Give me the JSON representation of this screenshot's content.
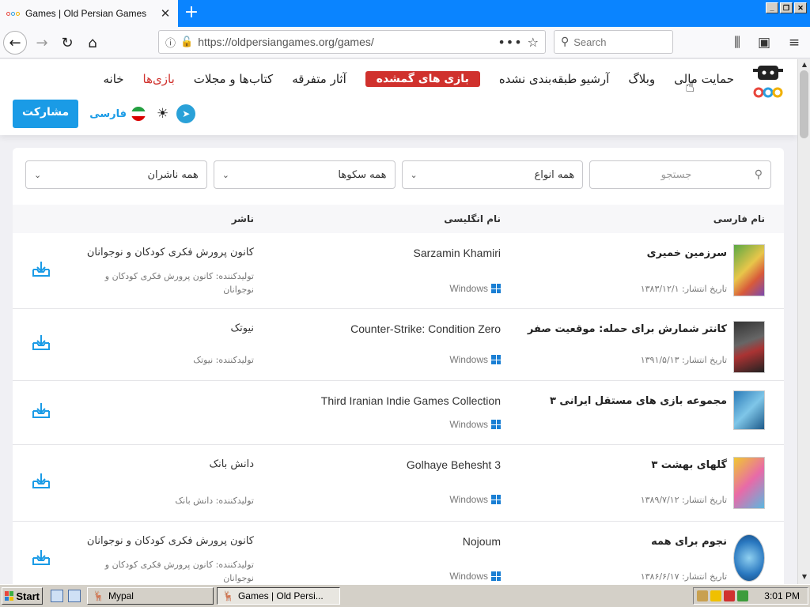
{
  "browser": {
    "tab_title": "Games | Old Persian Games",
    "tab_close": "✕",
    "new_tab": "+",
    "url": "https://oldpersiangames.org/games/",
    "search_placeholder": "Search"
  },
  "site": {
    "menu": [
      "خانه",
      "بازی‌ها",
      "کتاب‌ها و مجلات",
      "آثار متفرقه",
      "بازی های گمشده",
      "آرشیو طبقه‌بندی نشده",
      "وبلاگ",
      "حمایت مالی"
    ],
    "active_menu": "بازی‌ها",
    "lost_games_color": "#d0312d",
    "share_label": "مشارکت",
    "language_label": "فارسی",
    "accent_color": "#1a9be6"
  },
  "filters": {
    "search_placeholder": "جستجو",
    "types": "همه انواع",
    "platforms": "همه سکوها",
    "publishers": "همه ناشران"
  },
  "table": {
    "headers": {
      "fa_name": "نام فارسی",
      "en_name": "نام انگلیسی",
      "publisher": "ناشر"
    },
    "rows": [
      {
        "fa_title": "سرزمین خمیری",
        "date": "تاریخ انتشار: ۱۳۸۳/۱۲/۱",
        "en_title": "Sarzamin Khamiri",
        "platform": "Windows",
        "publisher": "کانون پرورش فکری کودکان و نوجوانان",
        "developer": "تولیدکننده: کانون پرورش فکری کودکان و نوجوانان"
      },
      {
        "fa_title": "کانتر شمارش برای حمله: موقعیت صفر",
        "date": "تاریخ انتشار: ۱۳۹۱/۵/۱۳",
        "en_title": "Counter-Strike: Condition Zero",
        "platform": "Windows",
        "publisher": "نیوتک",
        "developer": "تولیدکننده: نیوتک"
      },
      {
        "fa_title": "مجموعه بازی های مستقل ایرانی ۳",
        "date": "",
        "en_title": "Third Iranian Indie Games Collection",
        "platform": "Windows",
        "publisher": "",
        "developer": ""
      },
      {
        "fa_title": "گلهای بهشت ۳",
        "date": "تاریخ انتشار: ۱۳۸۹/۷/۱۲",
        "en_title": "Golhaye Behesht 3",
        "platform": "Windows",
        "publisher": "دانش بانک",
        "developer": "تولیدکننده: دانش بانک"
      },
      {
        "fa_title": "نجوم برای همه",
        "date": "تاریخ انتشار: ۱۳۸۶/۶/۱۷",
        "en_title": "Nojoum",
        "platform": "Windows",
        "publisher": "کانون پرورش فکری کودکان و نوجوانان",
        "developer": "تولیدکننده: کانون پرورش فکری کودکان و نوجوانان"
      }
    ]
  },
  "taskbar": {
    "start_label": "Start",
    "tasks": [
      "Mypal",
      "Games | Old Persi..."
    ],
    "clock": "3:01 PM"
  }
}
